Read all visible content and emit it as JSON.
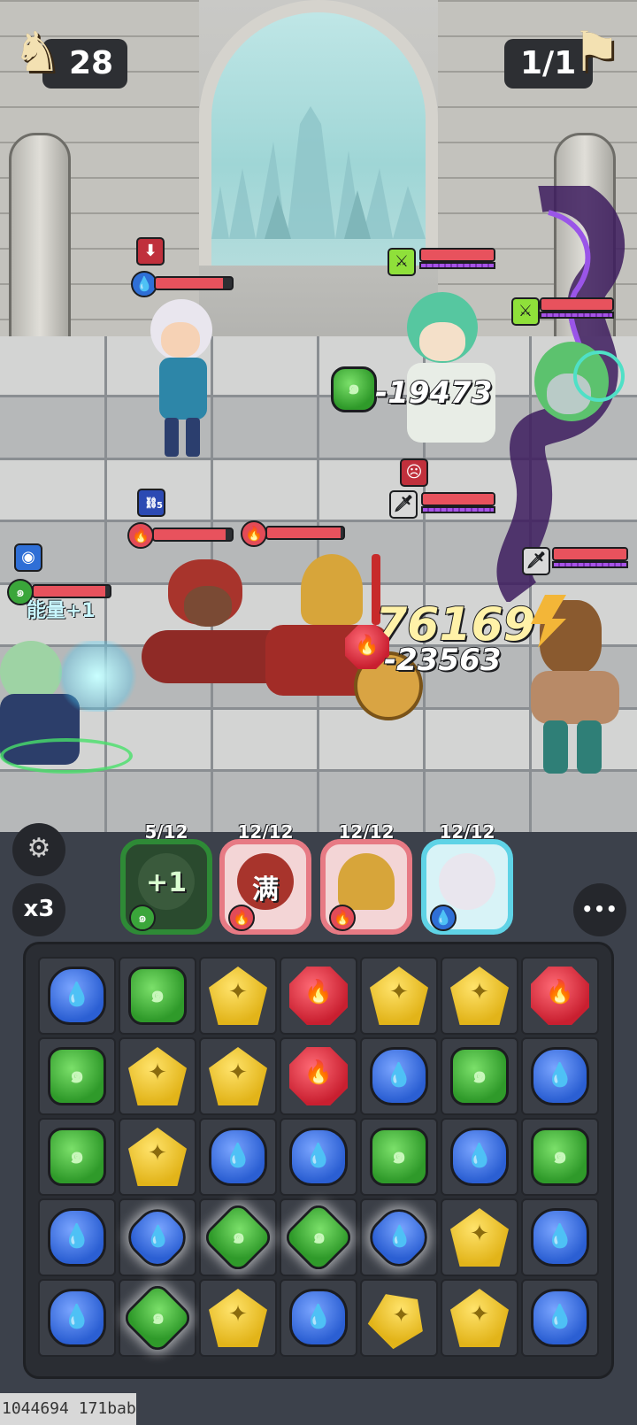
{
  "hud": {
    "moves_value": "28",
    "wave_value": "1/1",
    "moves_icon": "knight-chess-icon",
    "wave_icon": "flag-icon"
  },
  "battle": {
    "damage_numbers": {
      "green_hit": "-19473",
      "combo_hit": "76169",
      "red_hit": "-23563"
    },
    "energy_popup": "能量+1",
    "stack_badge": "5"
  },
  "heroes": [
    {
      "count": "5/12",
      "overlay": "+1",
      "frame_color": "#2e8a36"
    },
    {
      "count": "12/12",
      "overlay": "满",
      "frame_color": "#e77a84"
    },
    {
      "count": "12/12",
      "overlay": "",
      "frame_color": "#e77a84"
    },
    {
      "count": "12/12",
      "overlay": "",
      "frame_color": "#5fd3e6"
    }
  ],
  "controls": {
    "speed_label": "x3",
    "settings_icon": "gear-icon",
    "more_icon": "more-dots-icon",
    "more_label": "•••"
  },
  "board": {
    "rows": [
      [
        "blue",
        "green",
        "yellow",
        "red",
        "yellow",
        "yellow",
        "red"
      ],
      [
        "green",
        "yellow",
        "yellow",
        "red",
        "blue",
        "green",
        "blue"
      ],
      [
        "green",
        "yellow",
        "blue",
        "blue",
        "green",
        "blue",
        "green"
      ],
      [
        "blue",
        "blue*",
        "green*",
        "green*",
        "blue*",
        "yellow",
        "blue"
      ],
      [
        "blue",
        "green*",
        "yellow",
        "blue",
        "yellow*",
        "yellow",
        "blue"
      ]
    ],
    "glyphs": {
      "blue": "💧",
      "green": "๑",
      "yellow": "✦",
      "red": "🔥"
    }
  },
  "footer": {
    "build_id": "1044694 171bab"
  }
}
